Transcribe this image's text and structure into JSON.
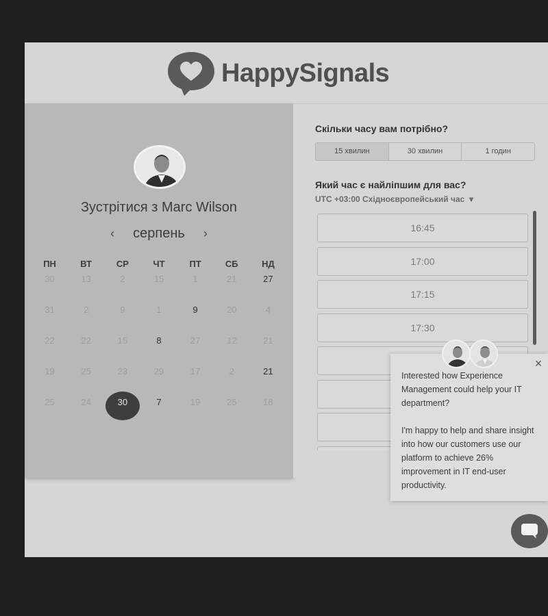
{
  "brand": {
    "name": "HappySignals"
  },
  "host": {
    "meet_label": "Зустрітися з Marc Wilson"
  },
  "calendar": {
    "month": "серпень",
    "prev": "‹",
    "next": "›",
    "weekdays": [
      "ПН",
      "ВТ",
      "СР",
      "ЧТ",
      "ПТ",
      "СБ",
      "НД"
    ],
    "days": [
      {
        "d": "30",
        "s": "off"
      },
      {
        "d": "13",
        "s": "off"
      },
      {
        "d": "2",
        "s": "off"
      },
      {
        "d": "15",
        "s": "off"
      },
      {
        "d": "1",
        "s": "off"
      },
      {
        "d": "21",
        "s": "off"
      },
      {
        "d": "27",
        "s": "avail"
      },
      {
        "d": "31",
        "s": "off"
      },
      {
        "d": "2",
        "s": "off"
      },
      {
        "d": "9",
        "s": "off"
      },
      {
        "d": "1",
        "s": "off"
      },
      {
        "d": "9",
        "s": "avail"
      },
      {
        "d": "20",
        "s": "off"
      },
      {
        "d": "4",
        "s": "off"
      },
      {
        "d": "22",
        "s": "off"
      },
      {
        "d": "22",
        "s": "off"
      },
      {
        "d": "15",
        "s": "off"
      },
      {
        "d": "8",
        "s": "avail"
      },
      {
        "d": "27",
        "s": "off"
      },
      {
        "d": "12",
        "s": "off"
      },
      {
        "d": "21",
        "s": "off"
      },
      {
        "d": "19",
        "s": "off"
      },
      {
        "d": "25",
        "s": "off"
      },
      {
        "d": "23",
        "s": "off"
      },
      {
        "d": "29",
        "s": "off"
      },
      {
        "d": "17",
        "s": "off"
      },
      {
        "d": "2",
        "s": "off"
      },
      {
        "d": "21",
        "s": "avail"
      },
      {
        "d": "25",
        "s": "off"
      },
      {
        "d": "24",
        "s": "off"
      },
      {
        "d": "30",
        "s": "selected"
      },
      {
        "d": "7",
        "s": "avail"
      },
      {
        "d": "19",
        "s": "off"
      },
      {
        "d": "25",
        "s": "off"
      },
      {
        "d": "18",
        "s": "off"
      }
    ]
  },
  "duration": {
    "question": "Скільки часу вам потрібно?",
    "options": [
      "15 хвилин",
      "30 хвилин",
      "1 годин"
    ],
    "selected": 0
  },
  "times": {
    "question": "Який час є найліпшим для вас?",
    "timezone": "UTC +03:00 Східноєвропейський час",
    "slots": [
      "16:45",
      "17:00",
      "17:15",
      "17:30",
      "",
      "",
      "",
      ""
    ]
  },
  "chat": {
    "close": "×",
    "message_1": "Interested how Experience Management could help your IT department?",
    "message_2": "I'm happy to help and share insight into how our customers use our platform to achieve 26% improvement in IT end-user productivity."
  },
  "colors": {
    "selected_day": "#3e3e3e",
    "panel": "#b8b8b8",
    "chat_button": "#595959"
  },
  "icons": [
    "heart-speech-logo-icon",
    "chevron-left-icon",
    "chevron-right-icon",
    "caret-down-icon",
    "close-icon",
    "chat-bubble-icon"
  ]
}
